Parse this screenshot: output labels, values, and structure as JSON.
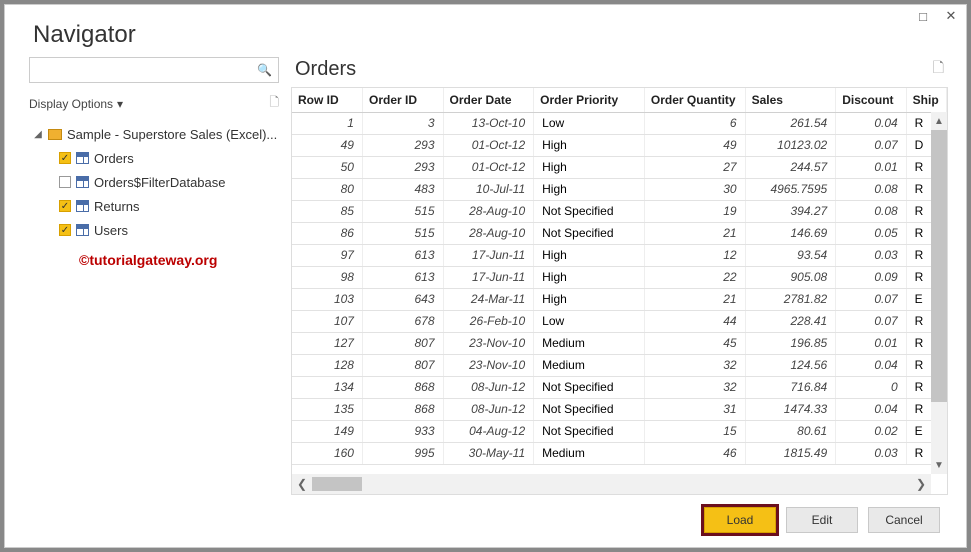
{
  "window": {
    "title": "Navigator"
  },
  "search": {
    "placeholder": ""
  },
  "display_options_label": "Display Options",
  "tree": {
    "root_label": "Sample - Superstore Sales (Excel)...",
    "items": [
      {
        "label": "Orders",
        "checked": true
      },
      {
        "label": "Orders$FilterDatabase",
        "checked": false
      },
      {
        "label": "Returns",
        "checked": true
      },
      {
        "label": "Users",
        "checked": true
      }
    ]
  },
  "watermark": "©tutorialgateway.org",
  "preview": {
    "title": "Orders",
    "columns": [
      "Row ID",
      "Order ID",
      "Order Date",
      "Order Priority",
      "Order Quantity",
      "Sales",
      "Discount",
      "Ship"
    ],
    "rows": [
      {
        "row_id": "1",
        "order_id": "3",
        "order_date": "13-Oct-10",
        "priority": "Low",
        "qty": "6",
        "sales": "261.54",
        "discount": "0.04",
        "ship": "R"
      },
      {
        "row_id": "49",
        "order_id": "293",
        "order_date": "01-Oct-12",
        "priority": "High",
        "qty": "49",
        "sales": "10123.02",
        "discount": "0.07",
        "ship": "D"
      },
      {
        "row_id": "50",
        "order_id": "293",
        "order_date": "01-Oct-12",
        "priority": "High",
        "qty": "27",
        "sales": "244.57",
        "discount": "0.01",
        "ship": "R"
      },
      {
        "row_id": "80",
        "order_id": "483",
        "order_date": "10-Jul-11",
        "priority": "High",
        "qty": "30",
        "sales": "4965.7595",
        "discount": "0.08",
        "ship": "R"
      },
      {
        "row_id": "85",
        "order_id": "515",
        "order_date": "28-Aug-10",
        "priority": "Not Specified",
        "qty": "19",
        "sales": "394.27",
        "discount": "0.08",
        "ship": "R"
      },
      {
        "row_id": "86",
        "order_id": "515",
        "order_date": "28-Aug-10",
        "priority": "Not Specified",
        "qty": "21",
        "sales": "146.69",
        "discount": "0.05",
        "ship": "R"
      },
      {
        "row_id": "97",
        "order_id": "613",
        "order_date": "17-Jun-11",
        "priority": "High",
        "qty": "12",
        "sales": "93.54",
        "discount": "0.03",
        "ship": "R"
      },
      {
        "row_id": "98",
        "order_id": "613",
        "order_date": "17-Jun-11",
        "priority": "High",
        "qty": "22",
        "sales": "905.08",
        "discount": "0.09",
        "ship": "R"
      },
      {
        "row_id": "103",
        "order_id": "643",
        "order_date": "24-Mar-11",
        "priority": "High",
        "qty": "21",
        "sales": "2781.82",
        "discount": "0.07",
        "ship": "E"
      },
      {
        "row_id": "107",
        "order_id": "678",
        "order_date": "26-Feb-10",
        "priority": "Low",
        "qty": "44",
        "sales": "228.41",
        "discount": "0.07",
        "ship": "R"
      },
      {
        "row_id": "127",
        "order_id": "807",
        "order_date": "23-Nov-10",
        "priority": "Medium",
        "qty": "45",
        "sales": "196.85",
        "discount": "0.01",
        "ship": "R"
      },
      {
        "row_id": "128",
        "order_id": "807",
        "order_date": "23-Nov-10",
        "priority": "Medium",
        "qty": "32",
        "sales": "124.56",
        "discount": "0.04",
        "ship": "R"
      },
      {
        "row_id": "134",
        "order_id": "868",
        "order_date": "08-Jun-12",
        "priority": "Not Specified",
        "qty": "32",
        "sales": "716.84",
        "discount": "0",
        "ship": "R"
      },
      {
        "row_id": "135",
        "order_id": "868",
        "order_date": "08-Jun-12",
        "priority": "Not Specified",
        "qty": "31",
        "sales": "1474.33",
        "discount": "0.04",
        "ship": "R"
      },
      {
        "row_id": "149",
        "order_id": "933",
        "order_date": "04-Aug-12",
        "priority": "Not Specified",
        "qty": "15",
        "sales": "80.61",
        "discount": "0.02",
        "ship": "E"
      },
      {
        "row_id": "160",
        "order_id": "995",
        "order_date": "30-May-11",
        "priority": "Medium",
        "qty": "46",
        "sales": "1815.49",
        "discount": "0.03",
        "ship": "R"
      }
    ]
  },
  "buttons": {
    "load": "Load",
    "edit": "Edit",
    "cancel": "Cancel"
  }
}
